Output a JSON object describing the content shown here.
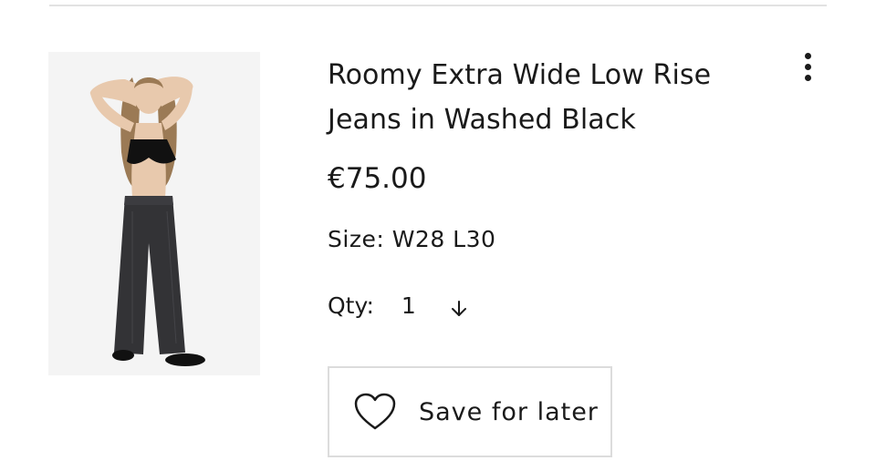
{
  "product": {
    "title": "Roomy Extra Wide Low Rise Jeans in Washed Black",
    "price": "€75.00",
    "size_text": "Size: W28 L30",
    "qty_label": "Qty:",
    "qty_value": "1",
    "image_alt": "Model wearing washed black extra wide low rise jeans"
  },
  "actions": {
    "save_for_later_label": "Save for later",
    "more_icon": "more-vertical-icon",
    "heart_icon": "heart-outline-icon",
    "qty_arrow_icon": "arrow-down-icon"
  },
  "colors": {
    "text": "#1a1a1a",
    "border": "#dcdcdc",
    "divider": "#e2e2e2",
    "image_bg": "#f4f4f4"
  }
}
